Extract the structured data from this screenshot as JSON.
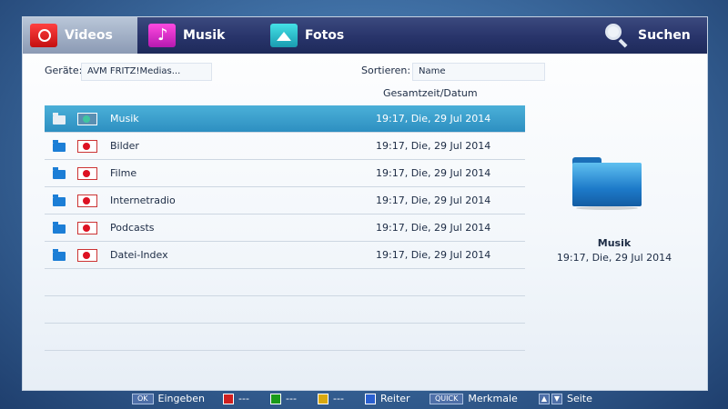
{
  "tabs": [
    {
      "label": "Videos",
      "icon": "videos-icon",
      "active": true
    },
    {
      "label": "Musik",
      "icon": "music-icon"
    },
    {
      "label": "Fotos",
      "icon": "photos-icon"
    }
  ],
  "search": {
    "label": "Suchen",
    "icon": "search-icon"
  },
  "device": {
    "label": "Geräte:",
    "value": "AVM FRITZ!Medias..."
  },
  "sort": {
    "label": "Sortieren:",
    "value": "Name"
  },
  "column_header": "Gesamtzeit/Datum",
  "rows": [
    {
      "name": "Musik",
      "date": "19:17, Die, 29 Jul 2014",
      "selected": true
    },
    {
      "name": "Bilder",
      "date": "19:17, Die, 29 Jul 2014"
    },
    {
      "name": "Filme",
      "date": "19:17, Die, 29 Jul 2014"
    },
    {
      "name": "Internetradio",
      "date": "19:17, Die, 29 Jul 2014"
    },
    {
      "name": "Podcasts",
      "date": "19:17, Die, 29 Jul 2014"
    },
    {
      "name": "Datei-Index",
      "date": "19:17, Die, 29 Jul 2014"
    }
  ],
  "preview": {
    "name": "Musik",
    "date": "19:17, Die, 29 Jul 2014",
    "icon": "folder-icon"
  },
  "footer": {
    "ok_key": "OK",
    "ok_label": "Eingeben",
    "red_label": "---",
    "green_label": "---",
    "yellow_label": "---",
    "blue_label": "Reiter",
    "quick_key": "QUICK",
    "quick_label": "Merkmale",
    "page_label": "Seite"
  },
  "colors": {
    "accent": "#2d8fc1",
    "tabbar": "#28346a"
  }
}
